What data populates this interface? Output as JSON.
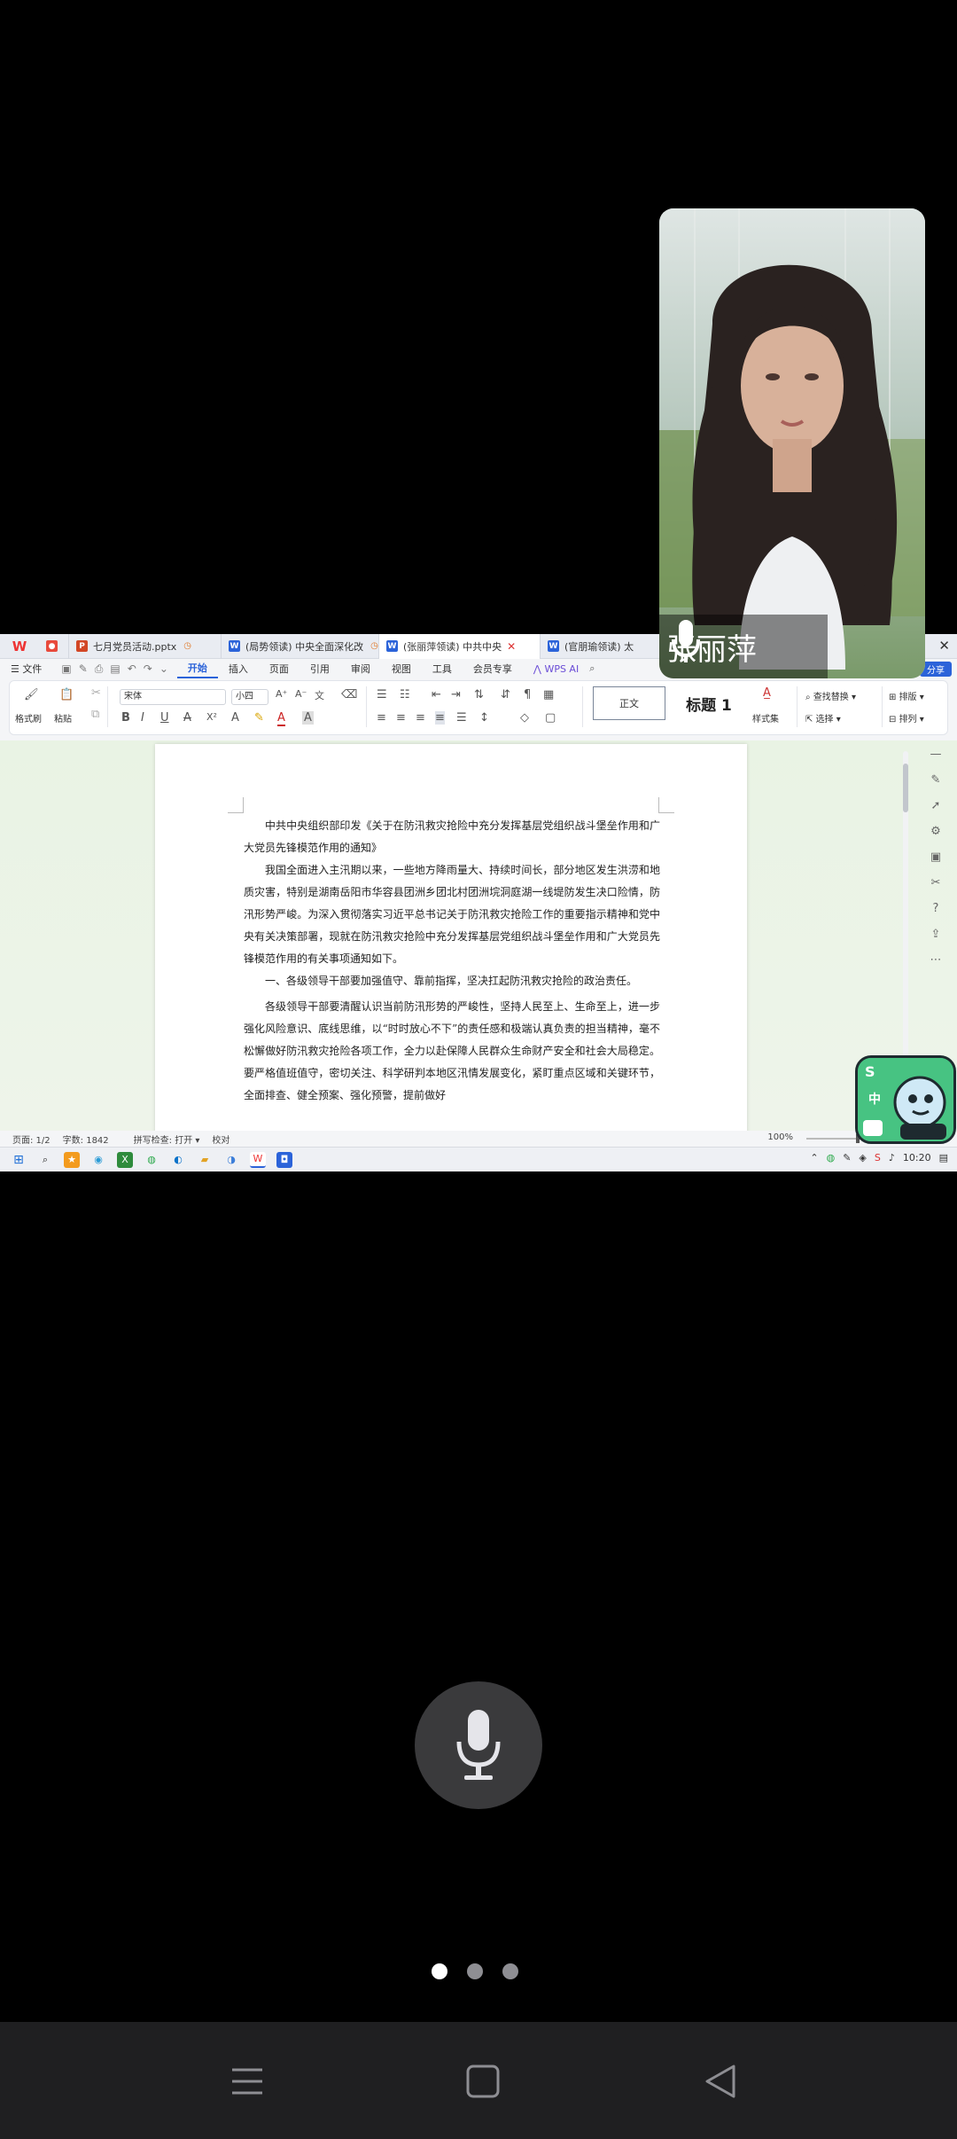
{
  "tabs": [
    {
      "label": "七月党员活动.pptx",
      "icon": "P",
      "color": "#d24726",
      "width": 172
    },
    {
      "label": "(局势领读) 中央全面深化改",
      "icon": "W",
      "color": "#2b63d9",
      "width": 178
    },
    {
      "label": "(张丽萍领读) 中共中央",
      "icon": "W",
      "color": "#2b63d9",
      "width": 182,
      "active": true
    },
    {
      "label": "(官朋瑜领读) 太",
      "icon": "W",
      "color": "#2b63d9",
      "width": 140
    }
  ],
  "menu": {
    "file": "文件",
    "items": [
      "开始",
      "插入",
      "页面",
      "引用",
      "审阅",
      "视图",
      "工具",
      "会员专享"
    ],
    "wps_ai": "WPS AI",
    "share": "分享"
  },
  "ribbon": {
    "format_painter": "格式刷",
    "paste": "粘贴",
    "font_name": "宋体",
    "font_size": "小四",
    "style_normal": "正文",
    "style_heading": "标题 1",
    "styles_set": "样式集",
    "find_replace": "查找替换",
    "select": "选择",
    "layout": "排版",
    "arrange": "排列"
  },
  "document": {
    "paragraphs": [
      "中共中央组织部印发《关于在防汛救灾抢险中充分发挥基层党组织战斗堡垒作用和广大党员先锋模范作用的通知》",
      "我国全面进入主汛期以来，一些地方降雨量大、持续时间长，部分地区发生洪涝和地质灾害，特别是湖南岳阳市华容县团洲乡团北村团洲垸洞庭湖一线堤防发生决口险情，防汛形势严峻。为深入贯彻落实习近平总书记关于防汛救灾抢险工作的重要指示精神和党中央有关决策部署，现就在防汛救灾抢险中充分发挥基层党组织战斗堡垒作用和广大党员先锋模范作用的有关事项通知如下。",
      "一、各级领导干部要加强值守、靠前指挥，坚决扛起防汛救灾抢险的政治责任。",
      "各级领导干部要清醒认识当前防汛形势的严峻性，坚持人民至上、生命至上，进一步强化风险意识、底线思维，以“时时放心不下”的责任感和极端认真负责的担当精神，毫不松懈做好防汛救灾抢险各项工作，全力以赴保障人民群众生命财产安全和社会大局稳定。要严格值班值守，密切关注、科学研判本地区汛情发展变化，紧盯重点区域和关键环节，全面排查、健全预案、强化预警，提前做好"
    ]
  },
  "status": {
    "page": "页面: 1/2",
    "words": "字数: 1842",
    "spellcheck": "拼写检查: 打开",
    "proofread": "校对",
    "zoom": "100%"
  },
  "taskbar": {
    "time": "10:20"
  },
  "video": {
    "speaker_name": "张丽萍"
  },
  "sticker": {
    "letter": "S",
    "label": "中"
  },
  "pager": {
    "count": 3,
    "active": 1
  }
}
